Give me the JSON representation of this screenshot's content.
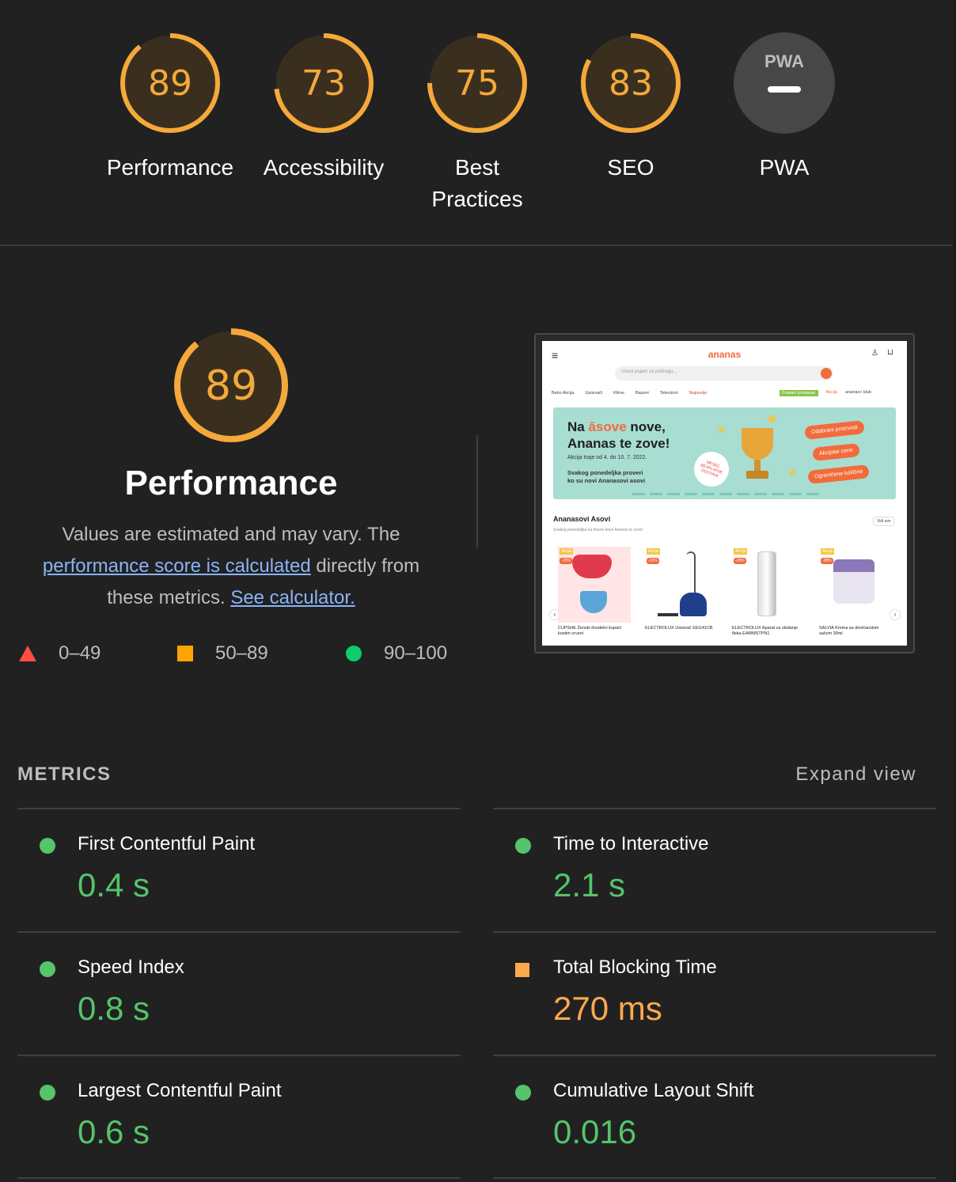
{
  "summary_gauges": [
    {
      "score": "89",
      "label": "Performance",
      "fraction": 0.89,
      "color": "#f4a93a"
    },
    {
      "score": "73",
      "label": "Accessibility",
      "fraction": 0.73,
      "color": "#f4a93a"
    },
    {
      "score": "75",
      "label": "Best Practices",
      "fraction": 0.75,
      "color": "#f4a93a"
    },
    {
      "score": "83",
      "label": "SEO",
      "fraction": 0.83,
      "color": "#f4a93a"
    }
  ],
  "pwa": {
    "badge_text": "PWA",
    "label": "PWA"
  },
  "performance": {
    "score": "89",
    "fraction": 0.89,
    "title": "Performance",
    "desc_prefix": "Values are estimated and may vary. The",
    "desc_link": "performance score is calculated",
    "desc_middle": "directly from these metrics.",
    "desc_calc_link": "See calculator."
  },
  "legend": [
    {
      "range": "0–49",
      "icon": "fail-triangle-icon",
      "color": "#ff4e42"
    },
    {
      "range": "50–89",
      "icon": "average-square-icon",
      "color": "#ffa400"
    },
    {
      "range": "90–100",
      "icon": "pass-circle-icon",
      "color": "#0cce6b"
    }
  ],
  "screenshot": {
    "logo": "ananas",
    "search_placeholder": "Unesi pojam za pretragu...",
    "nav": [
      "Beko Akcija",
      "Usisivači",
      "Klime",
      "Bazeni",
      "Televizori",
      "Najnovije"
    ],
    "nav_right": [
      "Postani prodavac",
      "Akcija",
      "ananas+ klub"
    ],
    "banner_title_1": "Na ",
    "banner_title_accent": "āsove",
    "banner_title_2": " nove,",
    "banner_title_line2": "Ananas te zove!",
    "banner_sub": "Akcija traje od 4. do 10. 7. 2022.",
    "banner_note_1": "Svakog ponedeljka proveri",
    "banner_note_2": "ko su novi Ananasovi asovi",
    "banner_badge": "MESEC BESPLATNE DOSTAVE",
    "banner_pills": [
      "Odabrani proizvodi",
      "Akcijske cene",
      "Ograničene količine"
    ],
    "section_title": "Ananasovi Asovi",
    "section_sub": "Svakog ponedeljka na Asove nove Ananas te zove!",
    "section_btn": "Vidi sve",
    "products": [
      {
        "tag": "Akcija",
        "disc": "-15%",
        "name": "CUPSHE Ženski dvodelni kupaći kostim crveni"
      },
      {
        "tag": "Akcija",
        "disc": "-21%",
        "name": "ELECTROLUX Usisivač EEG41CB"
      },
      {
        "tag": "Akcija",
        "disc": "-25%",
        "name": "ELECTROLUX Aparat za skidanje fleka E4WMSTPN1"
      },
      {
        "tag": "Akcija",
        "disc": "-38%",
        "name": "SALVIA Krema sa devičanskim sačem 30ml"
      }
    ]
  },
  "metrics": {
    "heading": "METRICS",
    "expand": "Expand view",
    "items": [
      {
        "name": "First Contentful Paint",
        "value": "0.4 s",
        "status": "pass"
      },
      {
        "name": "Time to Interactive",
        "value": "2.1 s",
        "status": "pass"
      },
      {
        "name": "Speed Index",
        "value": "0.8 s",
        "status": "pass"
      },
      {
        "name": "Total Blocking Time",
        "value": "270 ms",
        "status": "average"
      },
      {
        "name": "Largest Contentful Paint",
        "value": "0.6 s",
        "status": "pass"
      },
      {
        "name": "Cumulative Layout Shift",
        "value": "0.016",
        "status": "pass"
      }
    ]
  }
}
